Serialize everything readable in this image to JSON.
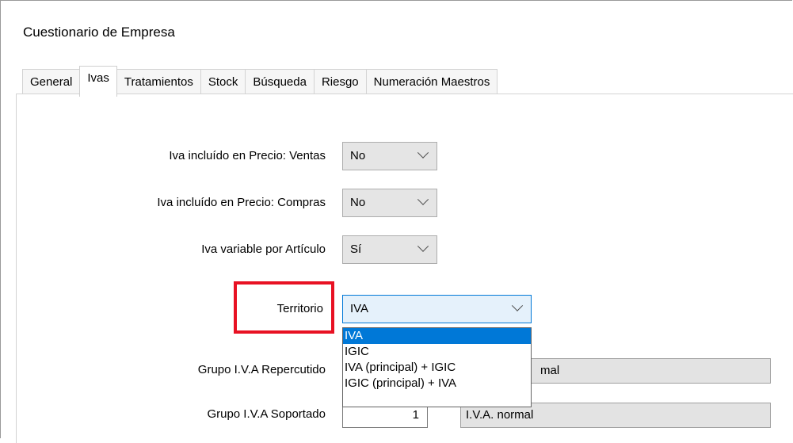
{
  "window": {
    "title": "Cuestionario de Empresa"
  },
  "tabs": [
    {
      "label": "General"
    },
    {
      "label": "Ivas"
    },
    {
      "label": "Tratamientos"
    },
    {
      "label": "Stock"
    },
    {
      "label": "Búsqueda"
    },
    {
      "label": "Riesgo"
    },
    {
      "label": "Numeración Maestros"
    }
  ],
  "form": {
    "iva_ventas": {
      "label": "Iva incluído en Precio: Ventas",
      "value": "No"
    },
    "iva_compras": {
      "label": "Iva incluído en Precio: Compras",
      "value": "No"
    },
    "iva_variable": {
      "label": "Iva variable por Artículo",
      "value": "Sí"
    },
    "territorio": {
      "label": "Territorio",
      "value": "IVA",
      "options": [
        "IVA",
        "IGIC",
        "IVA (principal) + IGIC",
        "IGIC (principal) + IVA"
      ],
      "selected_index": 0
    },
    "grupo_repercutido": {
      "label": "Grupo I.V.A Repercutido",
      "code": "",
      "description": "I.V.A. normal",
      "visible_description": "mal"
    },
    "grupo_soportado": {
      "label": "Grupo I.V.A Soportado",
      "code": "1",
      "description": "I.V.A. normal"
    }
  },
  "colors": {
    "highlight": "#e81123",
    "selection": "#0078d7"
  }
}
